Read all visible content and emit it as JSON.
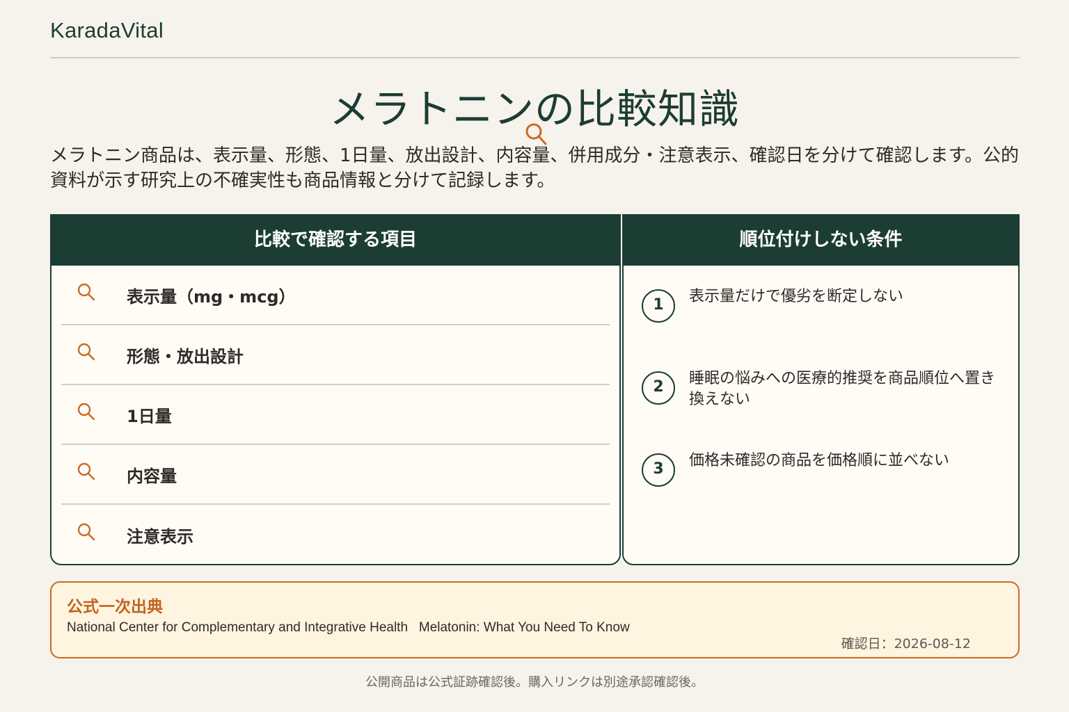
{
  "brand": "KaradaVital",
  "page_title": "メラトニンの比較知識",
  "intro": "メラトニン商品は、表示量、形態、1日量、放出設計、内容量、併用成分・注意表示、確認日を分けて確認します。公的資料が示す研究上の不確実性も商品情報と分けて記録します。",
  "checklist": {
    "heading": "比較で確認する項目",
    "icon": "magnifier-icon",
    "items": [
      {
        "label": "表示量（mg・mcg）"
      },
      {
        "label": "形態・放出設計"
      },
      {
        "label": "1日量"
      },
      {
        "label": "内容量"
      },
      {
        "label": "注意表示"
      }
    ]
  },
  "conditions": {
    "heading": "順位付けしない条件",
    "items": [
      {
        "num": "1",
        "text": "表示量だけで優劣を断定しない"
      },
      {
        "num": "2",
        "text": "睡眠の悩みへの医療的推奨を商品順位へ置き換えない"
      },
      {
        "num": "3",
        "text": "価格未確認の商品を価格順に並べない"
      }
    ]
  },
  "source": {
    "heading": "公式一次出典",
    "reference": "National Center for Complementary and Integrative Health   Melatonin: What You Need To Know",
    "checked_date": "確認日：2026-08-12"
  },
  "footer_note": "公開商品は公式証跡確認後。購入リンクは別途承認確認後。",
  "colors": {
    "primary": "#1c3d33",
    "accent": "#c86b24",
    "background": "#f6f2ec",
    "panel": "#fffcf6",
    "source_bg": "#fff4e0"
  }
}
